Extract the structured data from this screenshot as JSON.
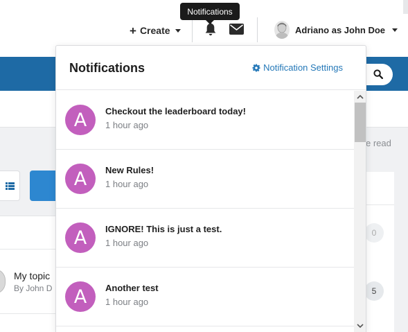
{
  "header": {
    "create_label": "Create",
    "user_name": "Adriano as John Doe",
    "tooltip": "Notifications",
    "icons": [
      "bell-icon",
      "mail-icon",
      "plus-icon",
      "caret-down-icon",
      "search-icon"
    ]
  },
  "background": {
    "mark_read_text": "e read",
    "topic_title": "My topic",
    "topic_meta": "By John D",
    "counts": [
      "0",
      "5"
    ]
  },
  "notifications": {
    "title": "Notifications",
    "settings_label": "Notification Settings",
    "items": [
      {
        "avatar_letter": "A",
        "text": "Checkout the leaderboard today!",
        "time": "1 hour ago"
      },
      {
        "avatar_letter": "A",
        "text": "New Rules!",
        "time": "1 hour ago"
      },
      {
        "avatar_letter": "A",
        "text": "IGNORE! This is just a test.",
        "time": "1 hour ago"
      },
      {
        "avatar_letter": "A",
        "text": "Another test",
        "time": "1 hour ago"
      }
    ]
  },
  "colors": {
    "nav_blue": "#1e6aa5",
    "avatar_purple": "#c25fbd",
    "link_blue": "#2478b8"
  }
}
